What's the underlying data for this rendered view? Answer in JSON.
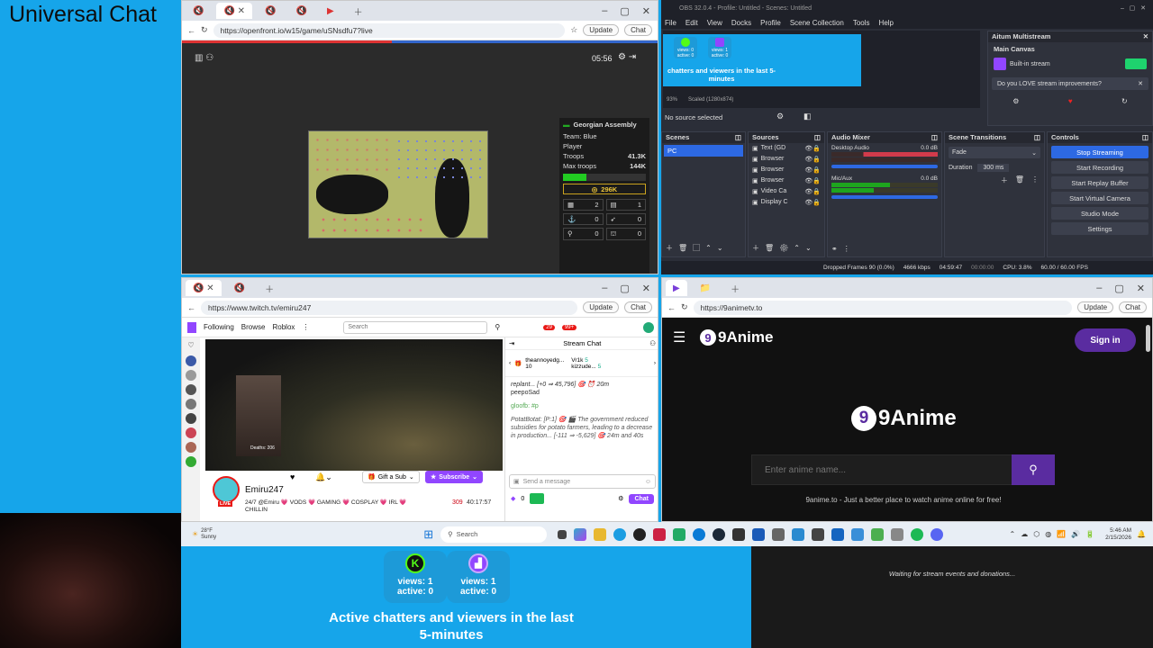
{
  "overlay": {
    "title": "Universal Chat"
  },
  "game_window": {
    "url": "https://openfront.io/w15/game/uSNsdfu7?live",
    "update_label": "Update",
    "chat_label": "Chat",
    "timer": "05:56",
    "player_panel": {
      "name": "Georgian Assembly",
      "team": "Team: Blue",
      "type": "Player",
      "troops_label": "Troops",
      "troops_value": "41.3K",
      "max_troops_label": "Max troops",
      "max_troops_value": "144K",
      "gold": "296K",
      "stats": [
        "2",
        "1",
        "0",
        "0",
        "0",
        "0"
      ]
    }
  },
  "obs": {
    "title": "OBS 32.0.4 - Profile: Untitled - Scenes: Untitled",
    "menu": [
      "File",
      "Edit",
      "View",
      "Docks",
      "Profile",
      "Scene Collection",
      "Tools",
      "Help"
    ],
    "preview_text": "chatters and viewers in the last 5-minutes",
    "preview_cards": [
      {
        "views": "views: 0",
        "active": "active: 0"
      },
      {
        "views": "views: 1",
        "active": "active: 0"
      }
    ],
    "zoom": "93%",
    "scaled": "Scaled (1280x874)",
    "no_source": "No source selected",
    "aitum": {
      "title": "Aitum Multistream",
      "canvas": "Main Canvas",
      "builtin": "Built-in stream",
      "promo": "Do you LOVE stream improvements?"
    },
    "scenes_title": "Scenes",
    "scenes": [
      "PC"
    ],
    "sources_title": "Sources",
    "sources": [
      "Text (GD",
      "Browser",
      "Browser",
      "Browser",
      "Video Ca",
      "Display C"
    ],
    "mixer_title": "Audio Mixer",
    "mixer": [
      {
        "name": "Desktop Audio",
        "db": "0.0 dB"
      },
      {
        "name": "Mic/Aux",
        "db": "0.0 dB"
      }
    ],
    "transitions_title": "Scene Transitions",
    "transition": "Fade",
    "duration_label": "Duration",
    "duration": "300 ms",
    "controls_title": "Controls",
    "controls": [
      "Stop Streaming",
      "Start Recording",
      "Start Replay Buffer",
      "Start Virtual Camera",
      "Studio Mode",
      "Settings"
    ],
    "status": {
      "dropped": "Dropped Frames 90 (0.0%)",
      "kbps": "4666 kbps",
      "live": "04:59:47",
      "rec": "00:00:00",
      "cpu": "CPU: 3.8%",
      "fps": "60.00 / 60.00 FPS"
    }
  },
  "twitch": {
    "url": "https://www.twitch.tv/emiru247",
    "nav": [
      "Following",
      "Browse",
      "Roblox"
    ],
    "search_placeholder": "Search",
    "badges": [
      "29",
      "99+"
    ],
    "streamer": "Emiru247",
    "live": "LIVE",
    "title_line": "24/7 @Emiru 💗 VODS 💗 GAMING 💗 COSPLAY 💗 IRL 💗 CHILLIN",
    "viewers": "309",
    "uptime": "40:17:57",
    "gift_label": "Gift a Sub",
    "subscribe_label": "Subscribe",
    "chat_title": "Stream Chat",
    "gifters": [
      {
        "name": "theannoyedg...",
        "count": "10"
      },
      {
        "name": "Vr1k",
        "count": "5"
      },
      {
        "name": "kizzude...",
        "count": "5"
      }
    ],
    "chat_lines": [
      "replant... [+0 ⇒ 45,796] 🎯 ⏰ 20m",
      "peepoSad",
      "gloofb: #p",
      "PotatBotat: [P:1] 🎯 🎬 The government reduced subsidies for potato farmers, leading to a decrease in production... [-111 ⇒ -5,629] 🎯 24m and 40s"
    ],
    "send_placeholder": "Send a message",
    "points": "0",
    "chat_button": "Chat",
    "video_badge": "Deaths: 206"
  },
  "nine_anime": {
    "url": "https://9animetv.to",
    "logo": "9Anime",
    "sign_in": "Sign in",
    "search_placeholder": "Enter anime name...",
    "tagline": "9anime.to - Just a better place to watch anime online for free!",
    "update_label": "Update",
    "chat_label": "Chat"
  },
  "taskbar": {
    "weather_temp": "28°F",
    "weather_text": "Sunny",
    "search_label": "Search",
    "time": "5:46 AM",
    "date": "2/15/2026"
  },
  "bottom_overlay": {
    "cards": [
      {
        "views": "views: 1",
        "active": "active: 0"
      },
      {
        "views": "views: 1",
        "active": "active: 0"
      }
    ],
    "caption_line1": "Active chatters and viewers in the last",
    "caption_line2": "5-minutes"
  },
  "donations": {
    "text": "Waiting for stream events and donations..."
  },
  "colors": {
    "accent_blue": "#16a5ea",
    "twitch_purple": "#9146ff",
    "kick_green": "#53fc18",
    "obs_stop": "#2d69e3"
  }
}
